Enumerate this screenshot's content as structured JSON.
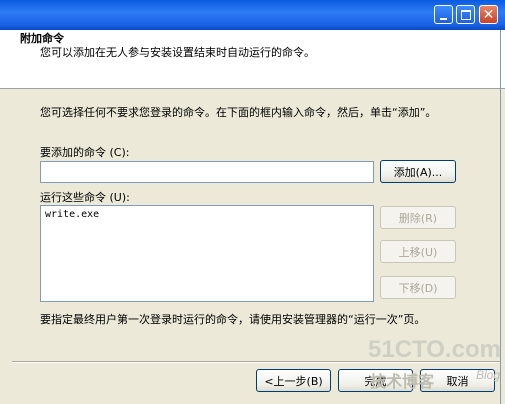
{
  "header": {
    "title": "附加命令",
    "subtitle": "您可以添加在无人参与安装设置结束时自动运行的命令。"
  },
  "body": {
    "instructions": "您可选择任何不要求您登录的命令。在下面的框内输入命令，然后，单击“添加”。",
    "add_label": "要添加的命令 (C):",
    "add_value": "",
    "run_label": "运行这些命令 (U):",
    "commands": [
      "write.exe"
    ],
    "footer_note": "要指定最终用户第一次登录时运行的命令，请使用安装管理器的“运行一次”页。"
  },
  "buttons": {
    "add": "添加(A)...",
    "delete": "删除(R)",
    "move_up": "上移(U)",
    "move_down": "下移(D)"
  },
  "nav": {
    "back": "<上一步(B)",
    "finish": "完成",
    "cancel": "取消"
  },
  "watermark": {
    "line1": "51CTO.com",
    "line2": "技术博客",
    "line3": "Blog"
  }
}
